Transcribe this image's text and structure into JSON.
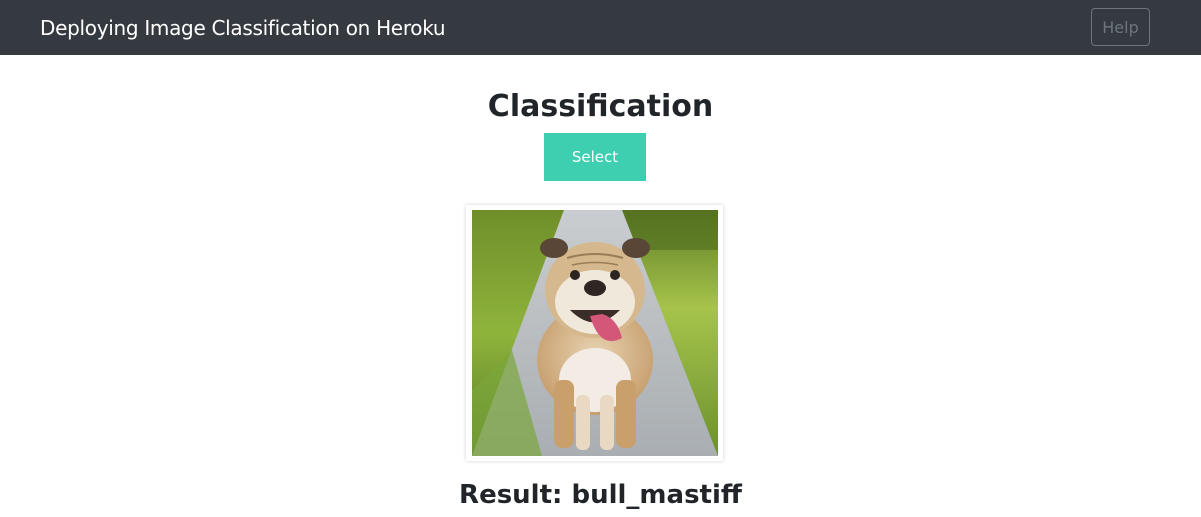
{
  "navbar": {
    "brand": "Deploying Image Classification on Heroku",
    "help_label": "Help"
  },
  "main": {
    "title": "Classification",
    "select_label": "Select",
    "image_icon": "bulldog-photo",
    "result_prefix": "Result: ",
    "result_value": "bull_mastiff"
  },
  "colors": {
    "navbar_bg": "#343a40",
    "select_button": "#3ecfb0",
    "help_border": "#6c757d"
  }
}
